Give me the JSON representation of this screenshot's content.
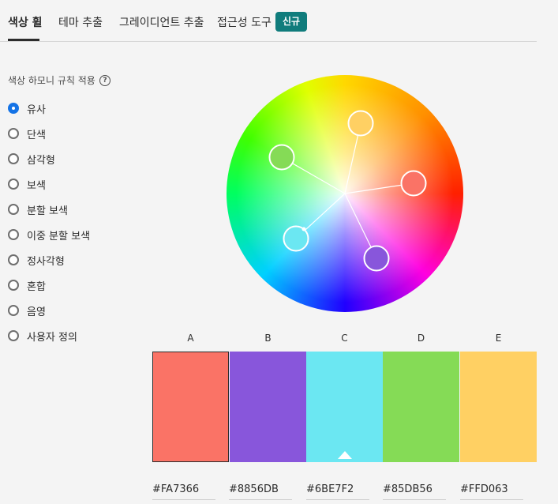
{
  "tabs": [
    {
      "label": "색상 휠"
    },
    {
      "label": "테마 추출"
    },
    {
      "label": "그레이디언트 추출"
    },
    {
      "label": "접근성 도구"
    }
  ],
  "badge": "신규",
  "harmony": {
    "title": "색상 하모니 규칙 적용",
    "help_glyph": "?",
    "selected": "유사",
    "options": [
      "유사",
      "단색",
      "삼각형",
      "보색",
      "분할 보색",
      "이중 분할 보색",
      "정사각형",
      "혼합",
      "음영",
      "사용자 정의"
    ]
  },
  "swatches": [
    {
      "label": "A",
      "hex": "#FA7366",
      "color": "#FA7366"
    },
    {
      "label": "B",
      "hex": "#8856DB",
      "color": "#8856DB"
    },
    {
      "label": "C",
      "hex": "#6BE7F2",
      "color": "#6BE7F2"
    },
    {
      "label": "D",
      "hex": "#85DB56",
      "color": "#85DB56"
    },
    {
      "label": "E",
      "hex": "#FFD063",
      "color": "#FFD063"
    }
  ],
  "base_color": "C",
  "selected_swatch": "A"
}
